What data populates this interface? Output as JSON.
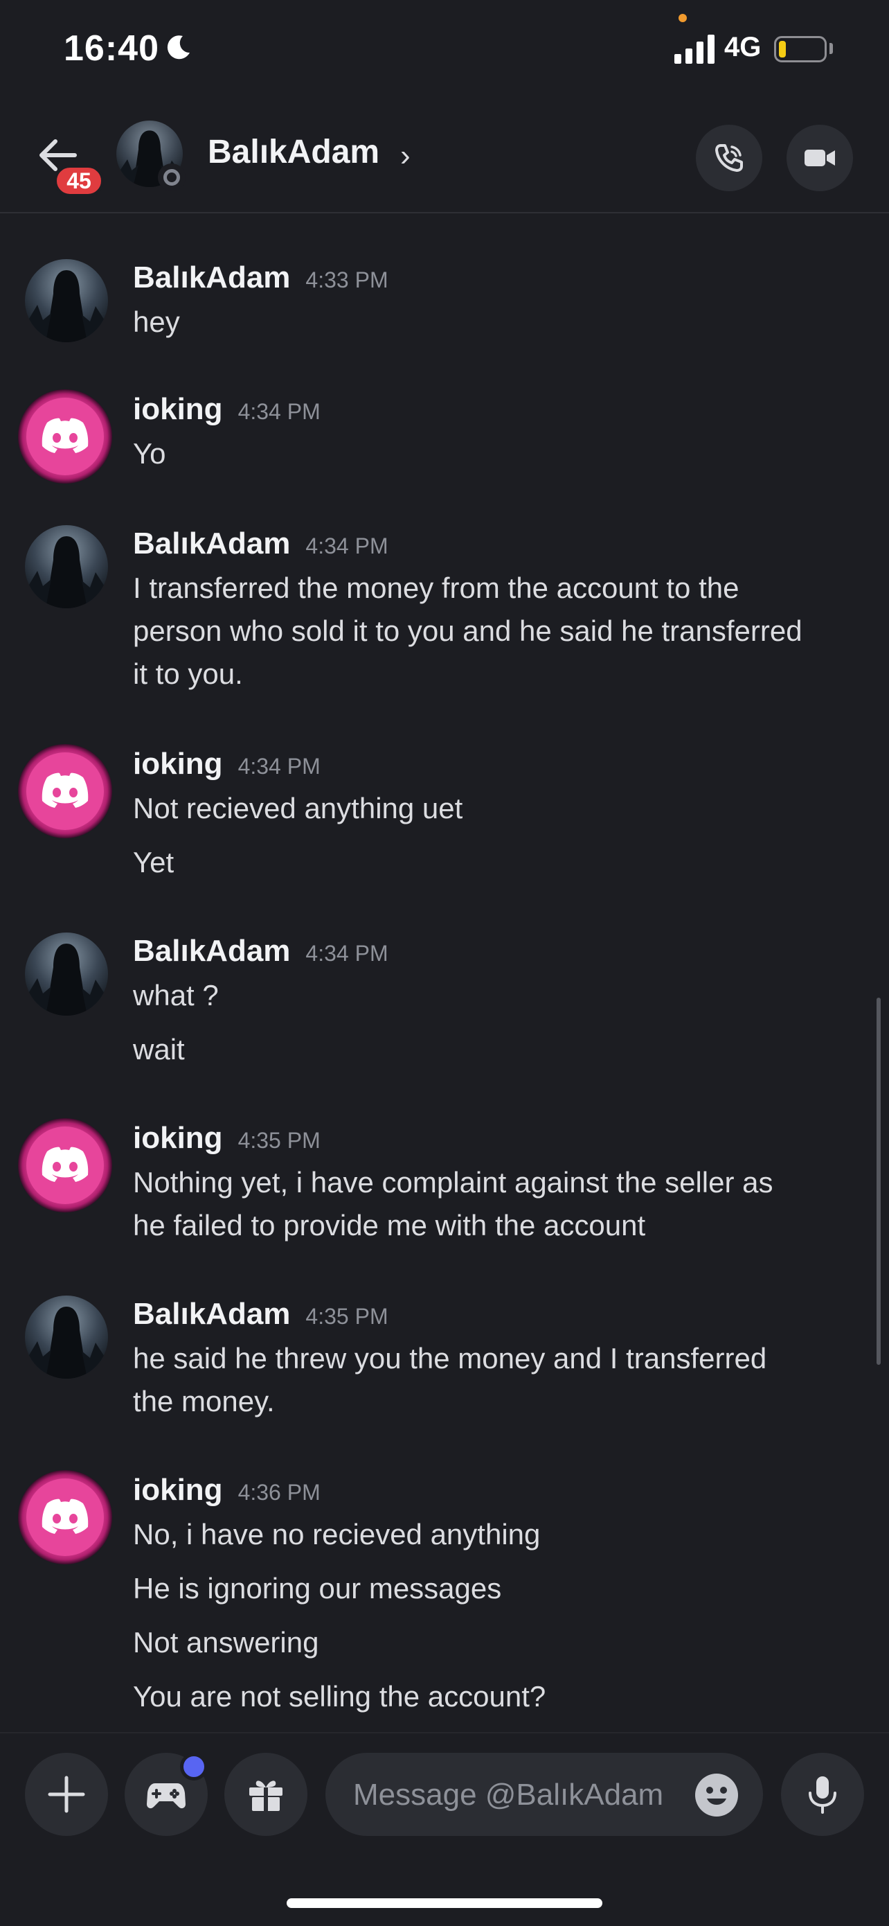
{
  "status_bar": {
    "time": "16:40",
    "network": "4G",
    "battery_level": 0.15
  },
  "header": {
    "unread_count": "45",
    "name": "BalıkAdam"
  },
  "messages": [
    {
      "author": "BalıkAdam",
      "time": "4:33 PM",
      "lines": [
        "hey"
      ]
    },
    {
      "author": "ioking",
      "time": "4:34 PM",
      "lines": [
        "Yo"
      ]
    },
    {
      "author": "BalıkAdam",
      "time": "4:34 PM",
      "lines": [
        "I transferred the money from the account to the",
        "person who sold it to you and he said he transferred",
        "it to you."
      ]
    },
    {
      "author": "ioking",
      "time": "4:34 PM",
      "lines": [
        "Not recieved anything uet",
        "Yet"
      ]
    },
    {
      "author": "BalıkAdam",
      "time": "4:34 PM",
      "lines": [
        "what ?",
        "wait"
      ]
    },
    {
      "author": "ioking",
      "time": "4:35 PM",
      "lines": [
        "Nothing yet, i have complaint against the seller as",
        "he failed to provide me with the account"
      ]
    },
    {
      "author": "BalıkAdam",
      "time": "4:35 PM",
      "lines": [
        "he said he threw you the money and I transferred",
        "the money."
      ]
    },
    {
      "author": "ioking",
      "time": "4:36 PM",
      "lines": [
        "No, i have no recieved anything",
        "He is ignoring our messages",
        "Not answering",
        "You are not selling the account?"
      ]
    }
  ],
  "composer": {
    "placeholder": "Message @BalıkAdam"
  },
  "icons": {
    "back": "arrow-left-icon",
    "call": "phone-icon",
    "video": "video-camera-icon",
    "plus": "plus-icon",
    "games": "gamepad-icon",
    "gift": "gift-icon",
    "emoji": "emoji-icon",
    "mic": "microphone-icon"
  },
  "colors": {
    "background": "#1c1d22",
    "badge": "#e03c3f",
    "blurple": "#5865f2",
    "ioking_avatar": "#e7459b",
    "battery": "#f5cc14"
  }
}
